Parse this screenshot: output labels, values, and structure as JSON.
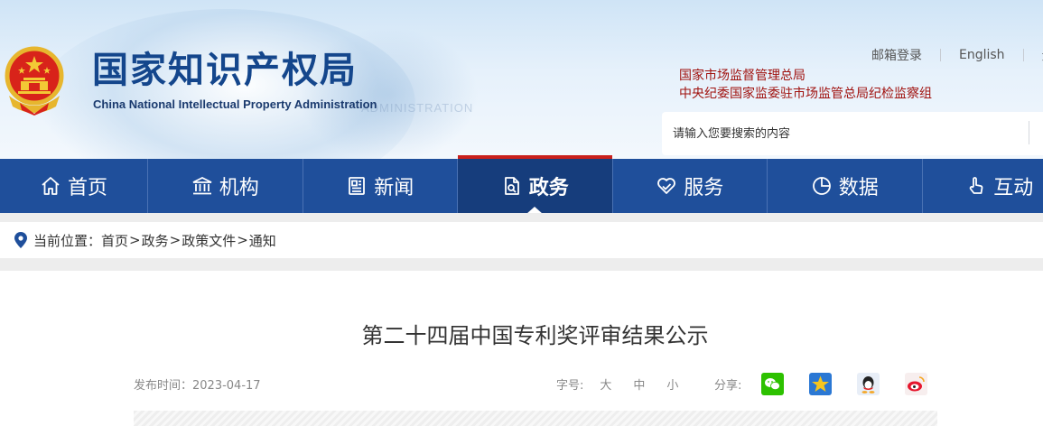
{
  "header": {
    "title": "国家知识产权局",
    "subtitle": "China National Intellectual Property Administration",
    "ghost_text": "ADMINISTRATION"
  },
  "toplinks": {
    "login": "邮箱登录",
    "english": "English",
    "third": "无"
  },
  "orgs": [
    "国家市场监督管理总局",
    "中央纪委国家监委驻市场监管总局纪检监察组"
  ],
  "search": {
    "placeholder": "请输入您要搜索的内容"
  },
  "nav": {
    "items": [
      {
        "label": "首页",
        "icon": "home-icon"
      },
      {
        "label": "机构",
        "icon": "institution-icon"
      },
      {
        "label": "新闻",
        "icon": "newspaper-icon"
      },
      {
        "label": "政务",
        "icon": "document-icon",
        "active": true
      },
      {
        "label": "服务",
        "icon": "service-heart-icon"
      },
      {
        "label": "数据",
        "icon": "pie-chart-icon"
      },
      {
        "label": "互动",
        "icon": "hand-pointer-icon"
      }
    ]
  },
  "breadcrumb": {
    "prefix": "当前位置：",
    "items": [
      "首页",
      "政务",
      "政策文件",
      "通知"
    ]
  },
  "article": {
    "title": "第二十四届中国专利奖评审结果公示",
    "publish_label": "发布时间：2023-04-17",
    "fontsize_label": "字号:",
    "font_sizes": [
      "大",
      "中",
      "小"
    ],
    "share_label": "分享:",
    "share_icons": [
      "wechat-icon",
      "qzone-icon",
      "qq-icon",
      "weibo-icon"
    ]
  },
  "colors": {
    "nav_bg": "#1f4f9b",
    "nav_active": "#163d7c",
    "accent_red": "#c8201c",
    "title_blue": "#14468c",
    "org_red": "#a0120f"
  }
}
